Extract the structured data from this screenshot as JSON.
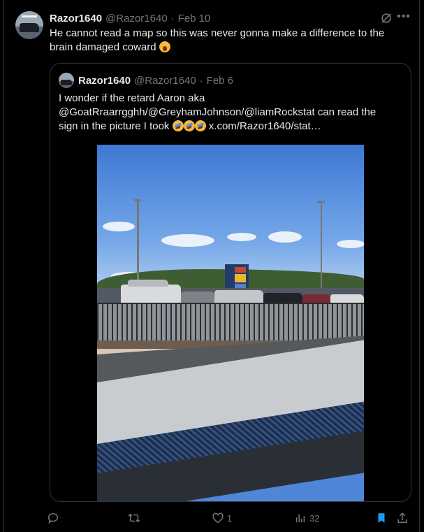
{
  "post": {
    "display_name": "Razor1640",
    "handle": "@Razor1640",
    "date_sep": "·",
    "date": "Feb 10",
    "text": "He cannot read a map so this was never gonna make a difference to the brain damaged coward",
    "emoji": "yawning-face"
  },
  "quoted": {
    "display_name": "Razor1640",
    "handle": "@Razor1640",
    "date_sep": "·",
    "date": "Feb 6",
    "text_line1": "I wonder if the retard Aaron aka",
    "text_line2": "@GoatRraarrgghh/@GreyhamJohnson/@liamRockstat can read the",
    "text_line3": "sign in the picture I took",
    "emojis": [
      "rofl",
      "rofl",
      "rofl"
    ],
    "link": "x.com/Razor1640/stat…",
    "media_alt": "Photo of a car park behind a fence next to a road"
  },
  "actions": {
    "reply_icon": "reply-icon",
    "repost_icon": "repost-icon",
    "like_icon": "like-icon",
    "like_count": "1",
    "views_icon": "views-icon",
    "views_count": "32",
    "bookmark_icon": "bookmark-icon",
    "share_icon": "share-icon"
  },
  "colors": {
    "background": "#000000",
    "text": "#e7e9ea",
    "muted": "#71767b",
    "border": "#2f3336",
    "bookmark_active": "#1d9bf0"
  }
}
